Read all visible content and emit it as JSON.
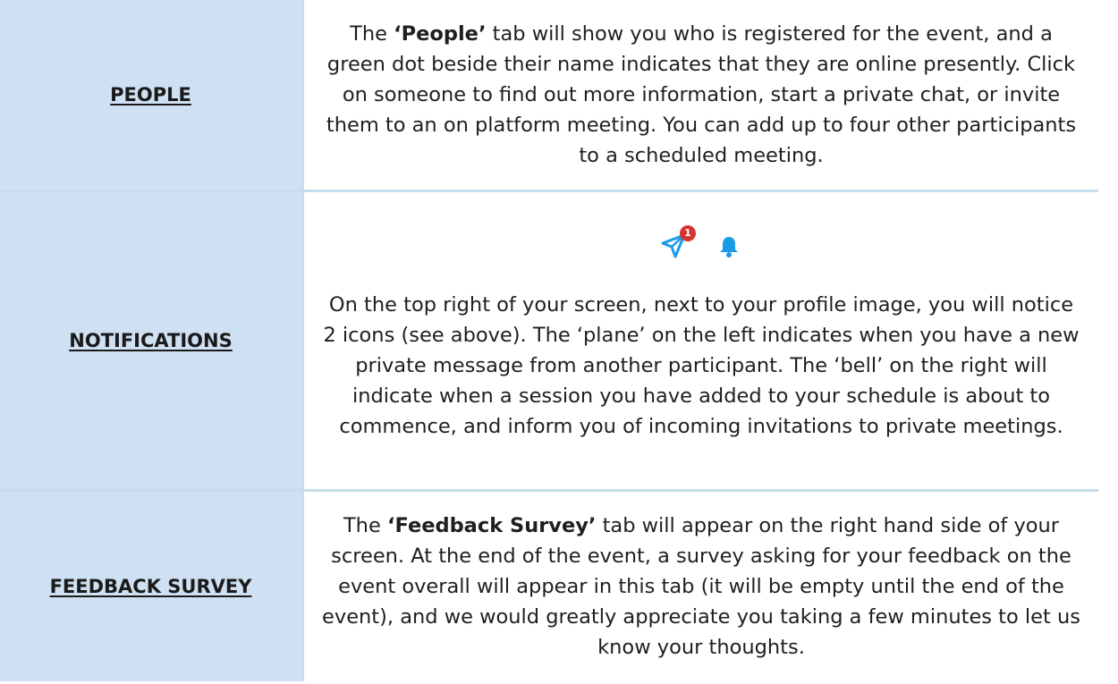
{
  "rows": [
    {
      "label": "PEOPLE",
      "segments": [
        {
          "text": "The ",
          "bold": false
        },
        {
          "text": "‘People’",
          "bold": true
        },
        {
          "text": " tab will show you who is registered for the event, and a green dot beside their name indicates that they are online presently. Click on someone to find out more information, start a private chat, or invite them to an on platform meeting. You can add up to four other participants to a scheduled meeting.",
          "bold": false
        }
      ]
    },
    {
      "label": "NOTIFICATIONS",
      "icons": {
        "plane": {
          "name": "paper-plane-icon",
          "badge": "1",
          "color": "#1a9be6",
          "badge_color": "#d4352e"
        },
        "bell": {
          "name": "bell-icon",
          "color": "#1a9be6"
        }
      },
      "segments": [
        {
          "text": "On the top right of your screen, next to your profile image, you will notice 2 icons (see above). The ‘plane’ on the left indicates when you have a new private message from another participant. The ‘bell’ on the right will indicate when a session you have added to your schedule is about to commence, and inform you of incoming invitations to private meetings.",
          "bold": false
        }
      ]
    },
    {
      "label": "FEEDBACK SURVEY",
      "segments": [
        {
          "text": "The ",
          "bold": false
        },
        {
          "text": "‘Feedback Survey’",
          "bold": true
        },
        {
          "text": " tab will appear on the right hand side of your screen. At the end of the event, a survey asking for your feedback on the event overall will appear in this tab (it will be empty until the end of the event), and we would greatly appreciate you taking a few minutes to let us know your thoughts.",
          "bold": false
        }
      ]
    }
  ],
  "colors": {
    "label_bg": "#cfe0f3",
    "border": "#c6ddeb",
    "text": "#1f1f1f"
  }
}
